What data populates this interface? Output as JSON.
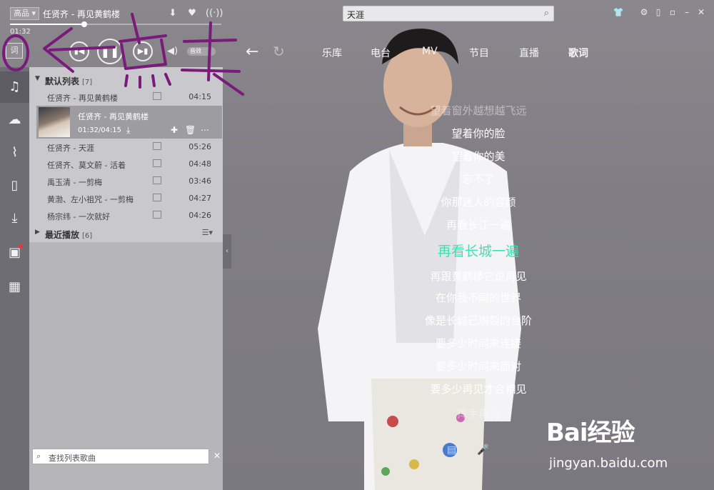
{
  "header": {
    "quality": "高品",
    "now_playing": "任贤齐 - 再见黄鹤楼",
    "current_time": "01:32",
    "progress": 0.35
  },
  "search": {
    "value": "天涯"
  },
  "transport": {
    "sound_label": "音效"
  },
  "tabs": [
    {
      "label": "乐库"
    },
    {
      "label": "电台"
    },
    {
      "label": "MV"
    },
    {
      "label": "节目"
    },
    {
      "label": "直播"
    },
    {
      "label": "歌词",
      "active": true
    }
  ],
  "sidebar": {
    "lyric_button": "词"
  },
  "playlist": {
    "default_group": {
      "name": "默认列表",
      "count": "[7]"
    },
    "now": {
      "title": "任贤齐 - 再见黄鹤楼",
      "time": "01:32/04:15"
    },
    "rows": [
      {
        "title": "任贤齐 - 再见黄鹤楼",
        "duration": "04:15"
      },
      {
        "title": "任贤齐 - 天涯",
        "duration": "05:26"
      },
      {
        "title": "任贤齐、莫文蔚 - 活着",
        "duration": "04:48"
      },
      {
        "title": "禹玉清 - 一剪梅",
        "duration": "03:46"
      },
      {
        "title": "黄渤、左小祖咒 - 一剪梅",
        "duration": "04:27"
      },
      {
        "title": "杨宗纬 - 一次就好",
        "duration": "04:26"
      }
    ],
    "recent_group": {
      "name": "最近播放",
      "count": "[6]"
    },
    "search_placeholder": "查找列表歌曲"
  },
  "lyrics": {
    "lines": [
      {
        "text": "望着窗外越想越飞远",
        "state": "faded"
      },
      {
        "text": "望着你的脸",
        "state": "normal"
      },
      {
        "text": "望着你的美",
        "state": "normal"
      },
      {
        "text": "忘不了",
        "state": "normal"
      },
      {
        "text": "你那迷人的容颜",
        "state": "normal"
      },
      {
        "text": "再看长江一遍",
        "state": "normal"
      },
      {
        "text": "再看长城一遍",
        "state": "current"
      },
      {
        "text": "再跟黄鹤楼它说再见",
        "state": "normal"
      },
      {
        "text": "在你我不同的世界",
        "state": "normal"
      },
      {
        "text": "像是长城已崩裂的台阶",
        "state": "normal"
      },
      {
        "text": "要多少时间来连接",
        "state": "normal"
      },
      {
        "text": "要多少时间来面对",
        "state": "normal"
      },
      {
        "text": "要多少再见才会相见",
        "state": "normal"
      },
      {
        "text": "挥手再见",
        "state": "faded"
      }
    ],
    "current_color": "#3fe0b5"
  },
  "watermark": {
    "brand": "Bai经验",
    "url": "jingyan.baidu.com"
  },
  "annotation": {
    "color": "#7a1a7a"
  }
}
